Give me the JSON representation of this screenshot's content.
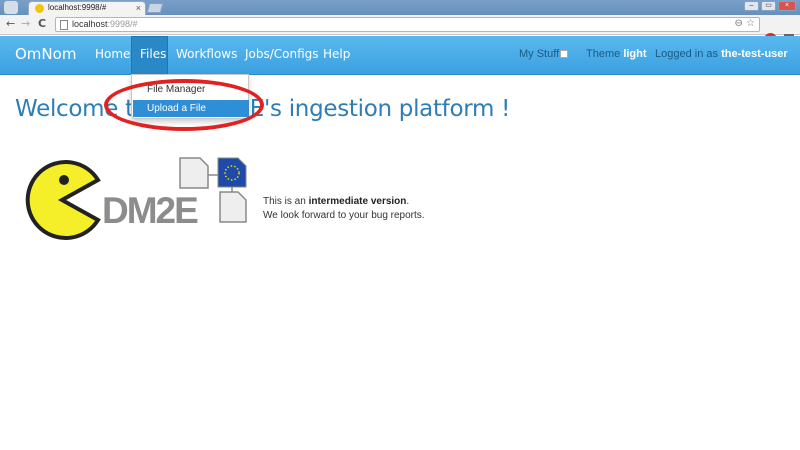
{
  "browser": {
    "tab_title": "localhost:9998/#",
    "tab_close": "×",
    "url_host": "localhost",
    "url_rest": ":9998/#",
    "back_icon": "←",
    "forward_icon": "→",
    "reload_icon": "C",
    "zoom_icon": "⊖",
    "star_icon": "☆",
    "extension_label": "ABP",
    "window_controls": [
      "–",
      "▭",
      "×"
    ]
  },
  "navbar": {
    "brand": "OmNom",
    "items": [
      "Home",
      "Files",
      "Workflows",
      "Jobs/Configs",
      "Help"
    ],
    "my_stuff": "My Stuff",
    "theme_label": "Theme",
    "theme_value": "light",
    "logged_in_label": "Logged in as",
    "user": "the-test-user"
  },
  "dropdown": {
    "items": [
      "File Manager",
      "Upload a File"
    ],
    "active_index": 1
  },
  "main": {
    "heading": "Welcome to the DM2E's ingestion platform !",
    "logo_text": "DM2E",
    "intro_prefix": "This is an ",
    "intro_bold": "intermediate version",
    "intro_suffix": ".",
    "intro_line2": "We look forward to your bug reports."
  },
  "colors": {
    "navbar": "#3ba1e0",
    "heading": "#2f7db5",
    "annotation": "#e02222",
    "active_item": "#2f8fd6"
  }
}
